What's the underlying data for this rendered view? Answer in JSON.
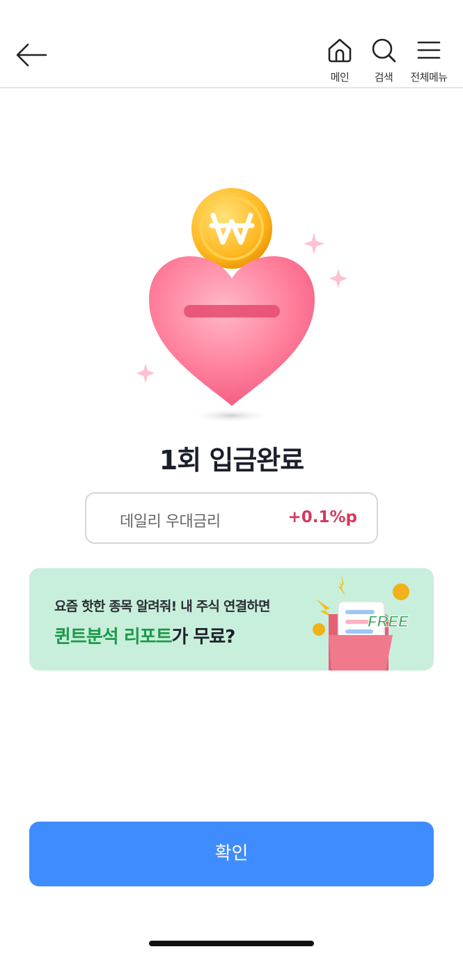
{
  "header": {
    "nav": {
      "home_label": "메인",
      "search_label": "검색",
      "menu_label": "전체메뉴"
    }
  },
  "icons": {
    "back": "arrow-left-icon",
    "home": "home-icon",
    "search": "search-icon",
    "menu": "hamburger-menu-icon",
    "illustration": "piggy-heart-coin-icon",
    "banner_art": "free-report-folder-icon"
  },
  "main": {
    "title": "1회 입금완료",
    "rate": {
      "label": "데일리 우대금리",
      "value": "+0.1%p"
    },
    "banner": {
      "line1": "요즘 핫한 종목 알려줘! 내 주식 연결하면",
      "line2_highlight": "퀸트분석 리포트",
      "line2_rest": "가 무료?",
      "badge": "FREE"
    },
    "confirm_label": "확인"
  },
  "colors": {
    "primary_button": "#3f8cff",
    "rate_value": "#d33b5e",
    "banner_bg": "#c8efdc",
    "banner_highlight": "#1e9a4a"
  }
}
